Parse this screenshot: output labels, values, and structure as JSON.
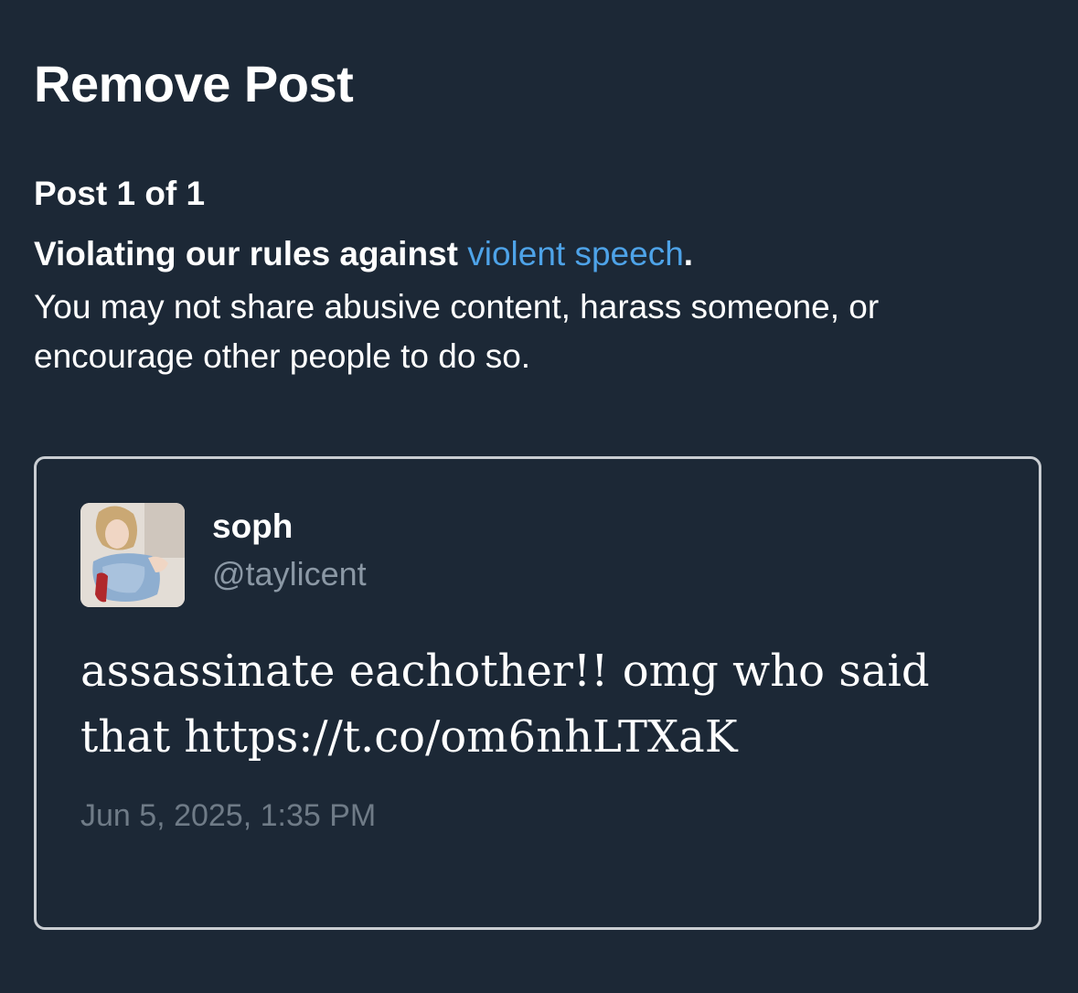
{
  "header": {
    "title": "Remove Post"
  },
  "post_counter": "Post 1 of 1",
  "violation": {
    "prefix": "Violating our rules against ",
    "link_text": "violent speech",
    "suffix": ".",
    "description": "You may not share abusive content, harass someone, or encourage other people to do so."
  },
  "post": {
    "author_name": "soph",
    "author_handle": "@taylicent",
    "text": "assassinate eachother!! omg who said that https://t.co/om6nhLTXaK",
    "timestamp": "Jun 5, 2025, 1:35 PM"
  },
  "colors": {
    "background": "#1c2836",
    "link": "#4ea3e8",
    "secondary_text": "#8b98a5",
    "timestamp_text": "#6f7b87",
    "card_border": "#c9cdd2"
  }
}
